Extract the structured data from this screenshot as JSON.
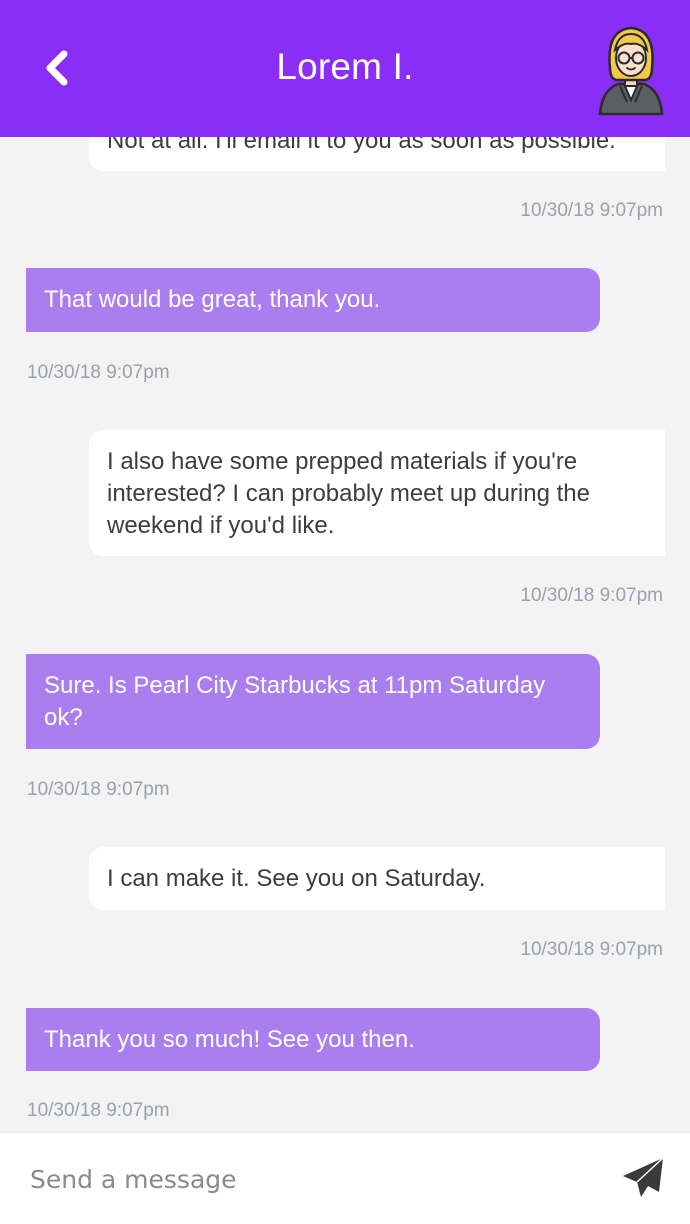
{
  "header": {
    "title": "Lorem I.",
    "back_icon": "chevron-left-icon",
    "avatar_icon": "avatar-woman-glasses",
    "bg_color": "#8a2ef5"
  },
  "messages": [
    {
      "from": "contact",
      "text": "Not at all. I'll email it to you as soon as possible.",
      "time": "10/30/18 9:07pm"
    },
    {
      "from": "me",
      "text": "That would be great, thank you.",
      "time": "10/30/18 9:07pm"
    },
    {
      "from": "contact",
      "text": "I also have some prepped materials if you're interested? I can probably meet up during the weekend if you'd like.",
      "time": "10/30/18 9:07pm"
    },
    {
      "from": "me",
      "text": "Sure. Is Pearl City Starbucks at 11pm Saturday ok?",
      "time": "10/30/18 9:07pm"
    },
    {
      "from": "contact",
      "text": "I can make it. See you on Saturday.",
      "time": "10/30/18 9:07pm"
    },
    {
      "from": "me",
      "text": "Thank you so much! See you then.",
      "time": "10/30/18 9:07pm"
    }
  ],
  "composer": {
    "placeholder": "Send a message",
    "send_icon": "paper-plane-icon"
  },
  "colors": {
    "outgoing_bubble": "#ab7ef0",
    "incoming_bubble": "#ffffff",
    "timestamp": "#98a2ae"
  }
}
